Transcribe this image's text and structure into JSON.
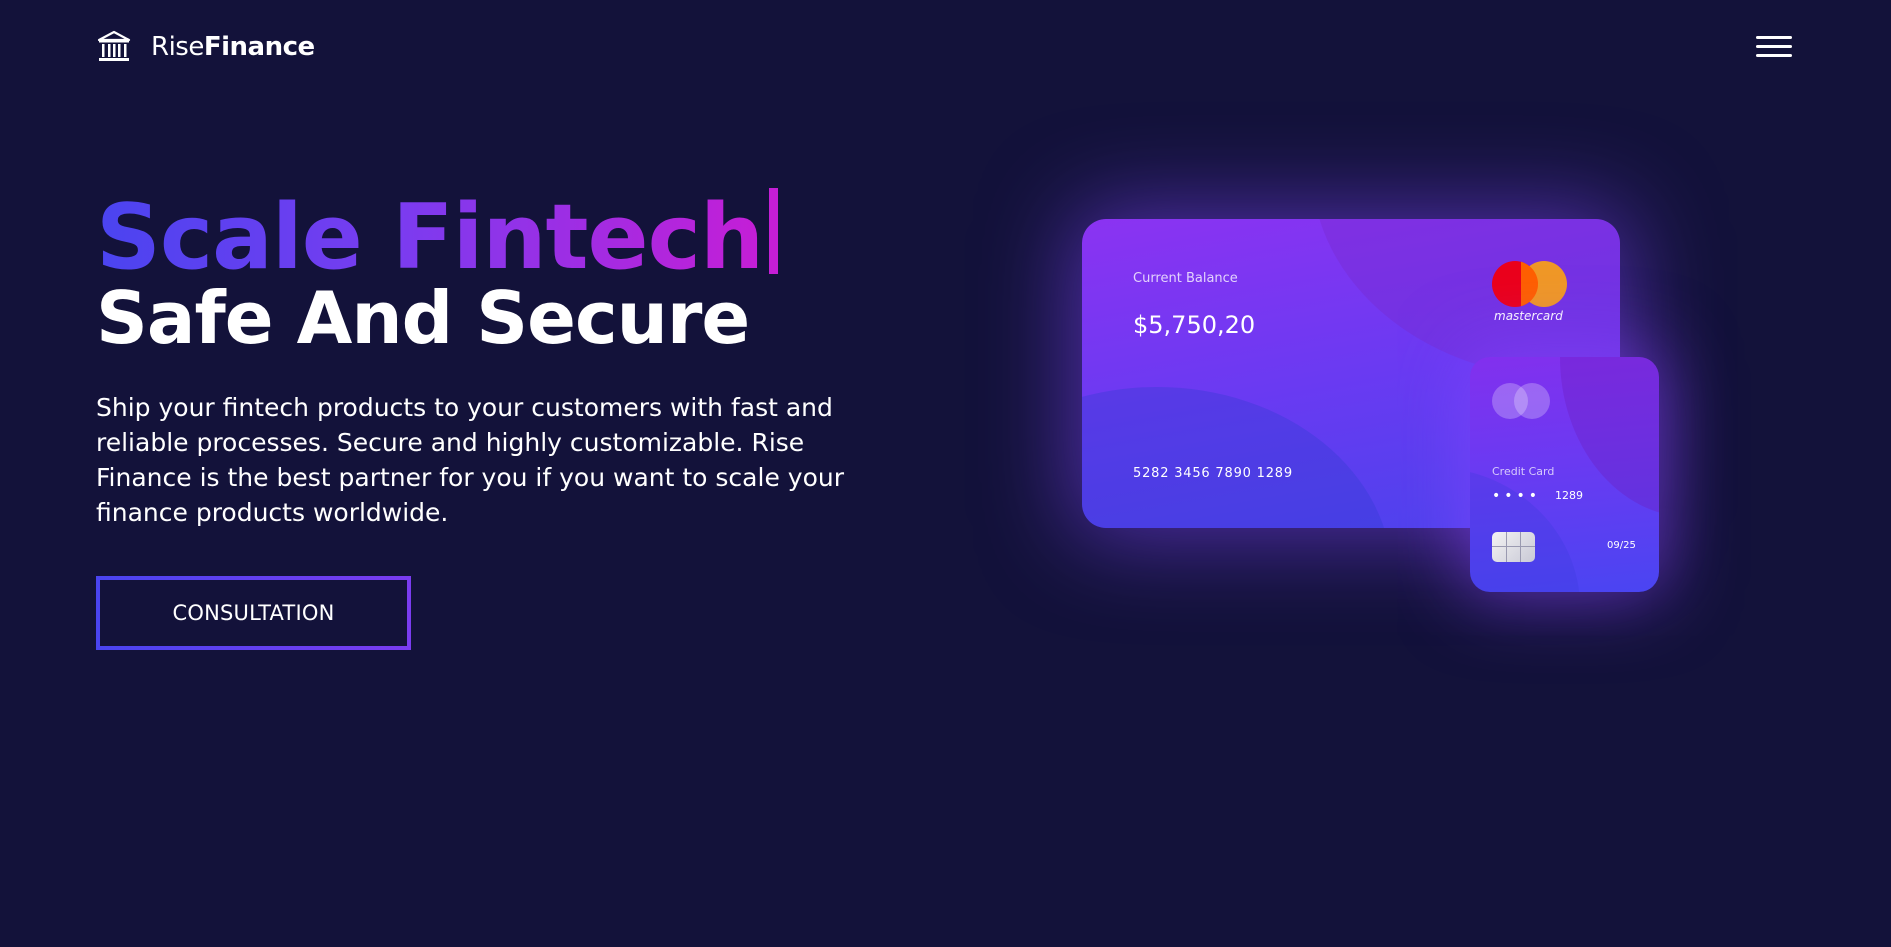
{
  "header": {
    "logo_icon": "bank-icon",
    "brand_light": "Rise",
    "brand_bold": "Finance",
    "menu_icon": "hamburger-menu-icon"
  },
  "hero": {
    "title_line1": "Scale Fintech",
    "title_line2": "Safe And Secure",
    "description": "Ship your fintech products to your customers with fast and reliable processes. Secure and highly customizable. Rise Finance is the best partner for you if you want to scale your finance products worldwide.",
    "cta_label": "CONSULTATION"
  },
  "main_card": {
    "balance_label": "Current Balance",
    "balance_value": "$5,750,20",
    "card_number": "5282 3456 7890 1289",
    "brand_text": "mastercard",
    "brand_icon": "mastercard-logo"
  },
  "small_card": {
    "label": "Credit Card",
    "masked": "••••",
    "last4": "1289",
    "expiry": "09/25",
    "chip_icon": "chip-icon"
  },
  "colors": {
    "background": "#13123a",
    "gradient_start": "#4a44f0",
    "gradient_mid": "#7a3cf0",
    "gradient_end": "#c51ed6",
    "card_purple": "#8b33f2"
  }
}
